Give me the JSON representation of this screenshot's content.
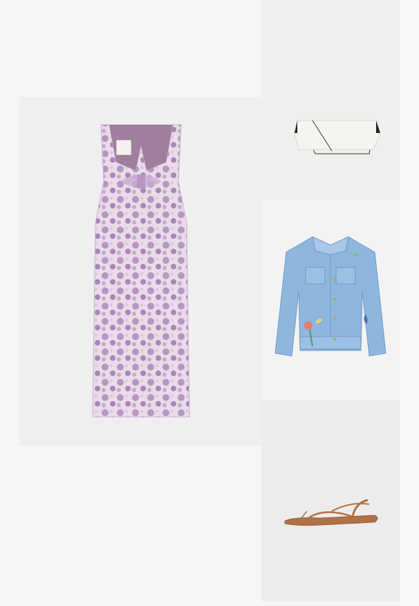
{
  "outfit": {
    "items": [
      {
        "item": "dress-icon",
        "color": "#b99ac4"
      },
      {
        "item": "bag-icon",
        "color": "#f2f2ee"
      },
      {
        "item": "denim-jacket-icon",
        "color": "#8fb7de"
      },
      {
        "item": "sandal-icon",
        "color": "#b07145"
      }
    ]
  }
}
